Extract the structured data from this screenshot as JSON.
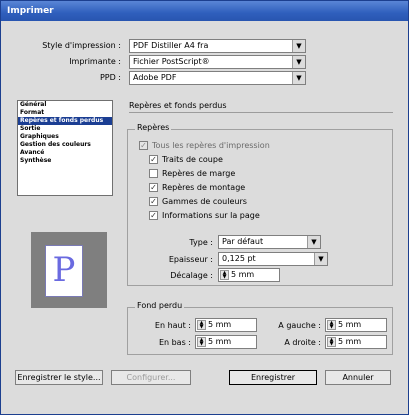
{
  "window": {
    "title": "Imprimer"
  },
  "header_fields": {
    "style_label": "Style d'impression :",
    "style_value": "PDF Distiller A4 fra",
    "printer_label": "Imprimante :",
    "printer_value": "Fichier PostScript®",
    "ppd_label": "PPD :",
    "ppd_value": "Adobe PDF"
  },
  "nav": {
    "items": [
      "Général",
      "Format",
      "Repères et fonds perdus",
      "Sortie",
      "Graphiques",
      "Gestion des couleurs",
      "Avancé",
      "Synthèse"
    ],
    "active_index": 2
  },
  "preview": {
    "letter": "P"
  },
  "section_title": "Repères et fonds perdus",
  "marks": {
    "group_title": "Repères",
    "all_marks_label": "Tous les repères d'impression",
    "trim_label": "Traits de coupe",
    "margin_label": "Repères de marge",
    "registration_label": "Repères de montage",
    "color_bars_label": "Gammes de couleurs",
    "page_info_label": "Informations sur la page",
    "type_label": "Type :",
    "type_value": "Par défaut",
    "weight_label": "Epaisseur :",
    "weight_value": "0,125 pt",
    "offset_label": "Décalage :",
    "offset_value": "5 mm"
  },
  "bleed": {
    "group_title": "Fond perdu",
    "top_label": "En haut :",
    "top_value": "5 mm",
    "bottom_label": "En bas :",
    "bottom_value": "5 mm",
    "left_label": "A gauche :",
    "left_value": "5 mm",
    "right_label": "A droite :",
    "right_value": "5 mm"
  },
  "buttons": {
    "save_style": "Enregistrer le style...",
    "configure": "Configurer...",
    "save": "Enregistrer",
    "cancel": "Annuler"
  }
}
